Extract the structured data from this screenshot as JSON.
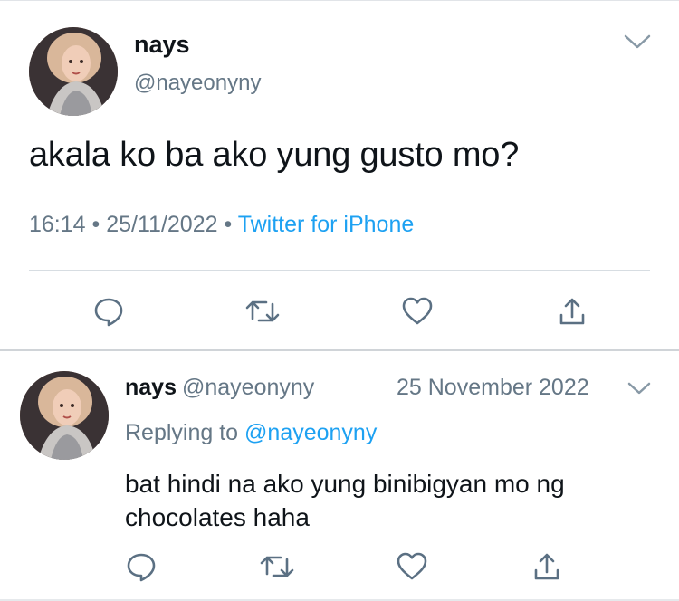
{
  "main_tweet": {
    "display_name": "nays",
    "handle": "@nayeonyny",
    "text": "akala ko ba ako yung gusto mo?",
    "time": "16:14",
    "date": "25/11/2022",
    "separator": "•",
    "source": "Twitter for iPhone"
  },
  "reply_tweet": {
    "display_name": "nays",
    "handle": "@nayeonyny",
    "date": "25 November 2022",
    "replying_prefix": "Replying to",
    "replying_to": "@nayeonyny",
    "text": "bat hindi na ako yung binibigyan mo ng chocolates haha"
  },
  "icons": {
    "reply": "reply-icon",
    "retweet": "retweet-icon",
    "like": "heart-icon",
    "share": "share-icon",
    "more": "chevron-down-icon"
  },
  "colors": {
    "link": "#1da1f2",
    "secondary": "#657786",
    "icon": "#5b7083",
    "text": "#0f1419"
  }
}
